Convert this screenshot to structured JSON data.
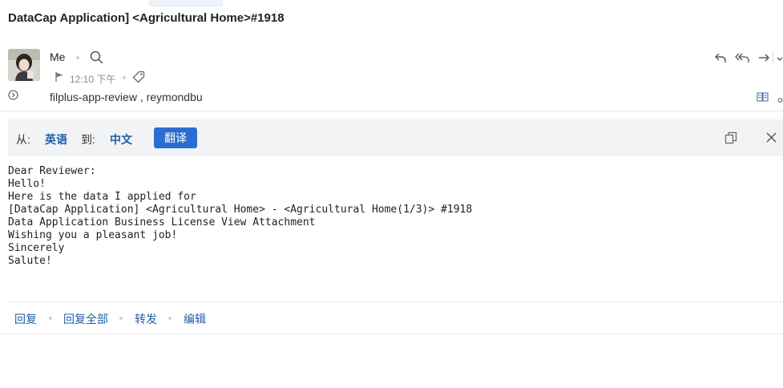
{
  "message": {
    "subject": "DataCap Application] <Agricultural Home>#1918",
    "sender": "Me",
    "time": "12:10 下午",
    "recipients": "filplus-app-review , reymondbu"
  },
  "translate": {
    "from_label": "从:",
    "from_lang": "英语",
    "to_label": "到:",
    "to_lang": "中文",
    "button": "翻译"
  },
  "body_lines": [
    "Dear Reviewer:",
    "Hello!",
    "Here is the data I applied for",
    "[DataCap Application] <Agricultural Home> - <Agricultural Home(1/3)> #1918",
    "Data Application Business License View Attachment",
    "Wishing you a pleasant job!",
    "Sincerely",
    "Salute!"
  ],
  "actions": {
    "reply": "回复",
    "reply_all": "回复全部",
    "forward": "转发",
    "edit": "编辑"
  },
  "icons": {
    "search": "search-icon",
    "flag": "flag-icon",
    "tag": "tag-icon",
    "expand": "expand-circle-icon",
    "reply": "reply-icon",
    "reply_all": "reply-all-icon",
    "forward": "forward-icon",
    "more": "chevron-down-icon",
    "read_mode": "book-icon",
    "copy": "copy-icon",
    "close": "close-icon"
  },
  "colors": {
    "link": "#1f5ea8",
    "primary_button": "#2c6ed0",
    "translate_bar_bg": "#f2f3f5"
  }
}
